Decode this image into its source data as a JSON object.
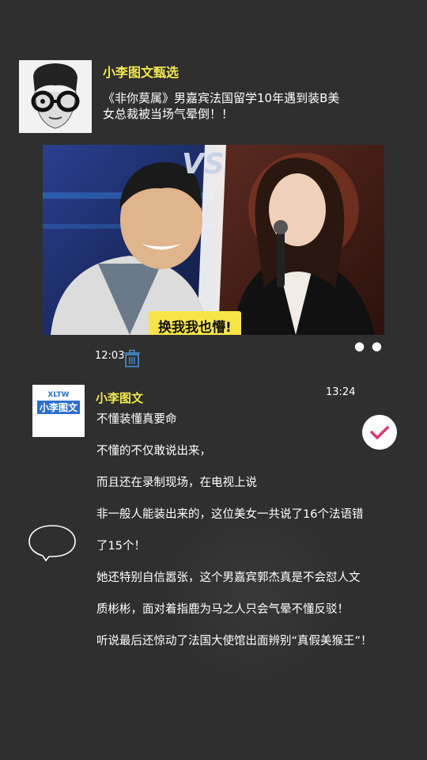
{
  "post": {
    "author": "小李图文甄选",
    "title": "《非你莫属》男嘉宾法国留学10年遇到装B美女总裁被当场气晕倒！！",
    "video_caption": "换我我也懵!",
    "vs_label": "VS",
    "time": "12:03",
    "more_icon": "more-dots-icon",
    "delete_icon": "trash-icon"
  },
  "message": {
    "author": "小李图文",
    "time": "13:24",
    "avatar_logo": "XLTW",
    "avatar_text": "小李图文",
    "lines": [
      "不懂装懂真要命",
      "不懂的不仅敢说出来，",
      "而且还在录制现场，在电视上说",
      "非一般人能装出来的，这位美女一共说了16个法语错",
      "了15个！",
      "她还特别自信嚣张，这个男嘉宾郭杰真是不会怼人文",
      "质彬彬，面对着指鹿为马之人只会气晕不懂反驳！",
      "听说最后还惊动了法国大使馆出面辨别“真假美猴王”！"
    ]
  },
  "colors": {
    "background": "#2f2f2f",
    "author": "#f3e94a",
    "check_accent": "#e0356b",
    "caption_bg": "#f7e545"
  }
}
